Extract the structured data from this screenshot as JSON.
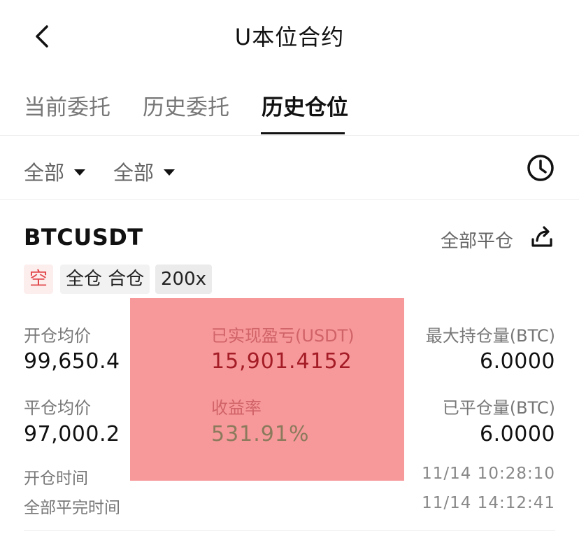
{
  "header": {
    "title": "U本位合约",
    "back_icon": "chevron-left-icon"
  },
  "tabs": [
    {
      "label": "当前委托",
      "active": false
    },
    {
      "label": "历史委托",
      "active": false
    },
    {
      "label": "历史仓位",
      "active": true
    }
  ],
  "filters": [
    {
      "label": "全部"
    },
    {
      "label": "全部"
    }
  ],
  "history_icon": "clock-icon",
  "position": {
    "symbol": "BTCUSDT",
    "close_all_label": "全部平仓",
    "share_icon": "share-icon",
    "tags": {
      "side": "空",
      "mode": "全仓 合仓",
      "leverage": "200x"
    },
    "open_price": {
      "label": "开仓均价",
      "value": "99,650.4"
    },
    "close_price": {
      "label": "平仓均价",
      "value": "97,000.2"
    },
    "realized_pnl": {
      "label": "已实现盈亏(USDT)",
      "value": "15,901.4152"
    },
    "roi": {
      "label": "收益率",
      "value": "531.91%"
    },
    "max_position": {
      "label": "最大持仓量(BTC)",
      "value": "6.0000"
    },
    "closed_amount": {
      "label": "已平仓量(BTC)",
      "value": "6.0000"
    },
    "open_time": {
      "label": "开仓时间",
      "value": "11/14 10:28:10"
    },
    "close_time": {
      "label": "全部平完时间",
      "value": "11/14 14:12:41"
    }
  },
  "colors": {
    "short": "#e0484c",
    "highlight": "#f7999b",
    "accent": "#111111"
  }
}
